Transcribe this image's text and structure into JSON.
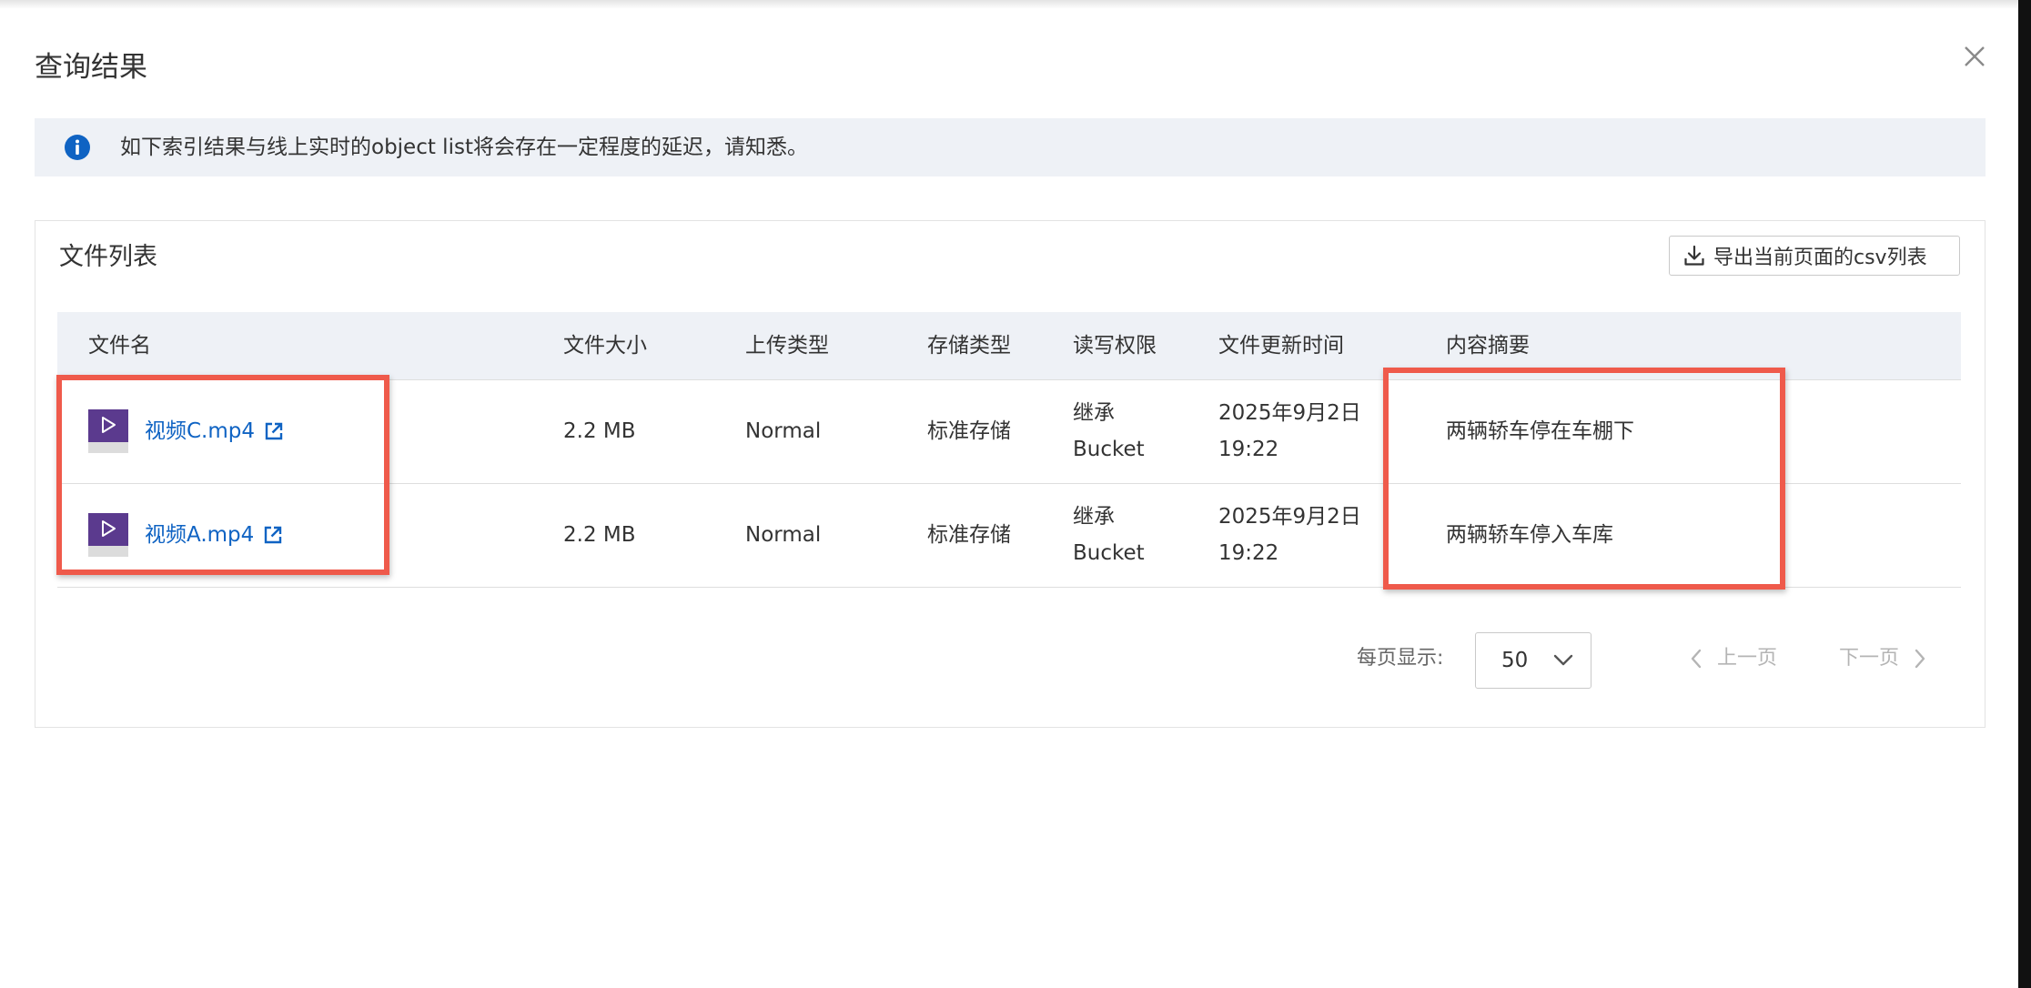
{
  "dialog": {
    "title": "查询结果"
  },
  "notice": {
    "icon": "info-icon",
    "text": "如下索引结果与线上实时的object list将会存在一定程度的延迟，请知悉。"
  },
  "panel": {
    "title": "文件列表",
    "export_label": "导出当前页面的csv列表"
  },
  "table": {
    "headers": {
      "name": "文件名",
      "size": "文件大小",
      "upload_type": "上传类型",
      "storage_type": "存储类型",
      "acl": "读写权限",
      "updated": "文件更新时间",
      "summary": "内容摘要"
    },
    "rows": [
      {
        "name": "视频C.mp4",
        "size": "2.2 MB",
        "upload_type": "Normal",
        "storage_type": "标准存储",
        "acl_line1": "继承",
        "acl_line2": "Bucket",
        "updated_line1": "2025年9月2日",
        "updated_line2": "19:22",
        "summary": "两辆轿车停在车棚下"
      },
      {
        "name": "视频A.mp4",
        "size": "2.2 MB",
        "upload_type": "Normal",
        "storage_type": "标准存储",
        "acl_line1": "继承",
        "acl_line2": "Bucket",
        "updated_line1": "2025年9月2日",
        "updated_line2": "19:22",
        "summary": "两辆轿车停入车库"
      }
    ]
  },
  "pagination": {
    "per_page_label": "每页显示:",
    "per_page_value": "50",
    "prev_label": "上一页",
    "next_label": "下一页"
  },
  "colors": {
    "link": "#0f63c3",
    "highlight": "#ef5a4b",
    "notice_bg": "#eef1f6",
    "video_icon": "#5b3a8e",
    "info_icon": "#0f63c3"
  }
}
